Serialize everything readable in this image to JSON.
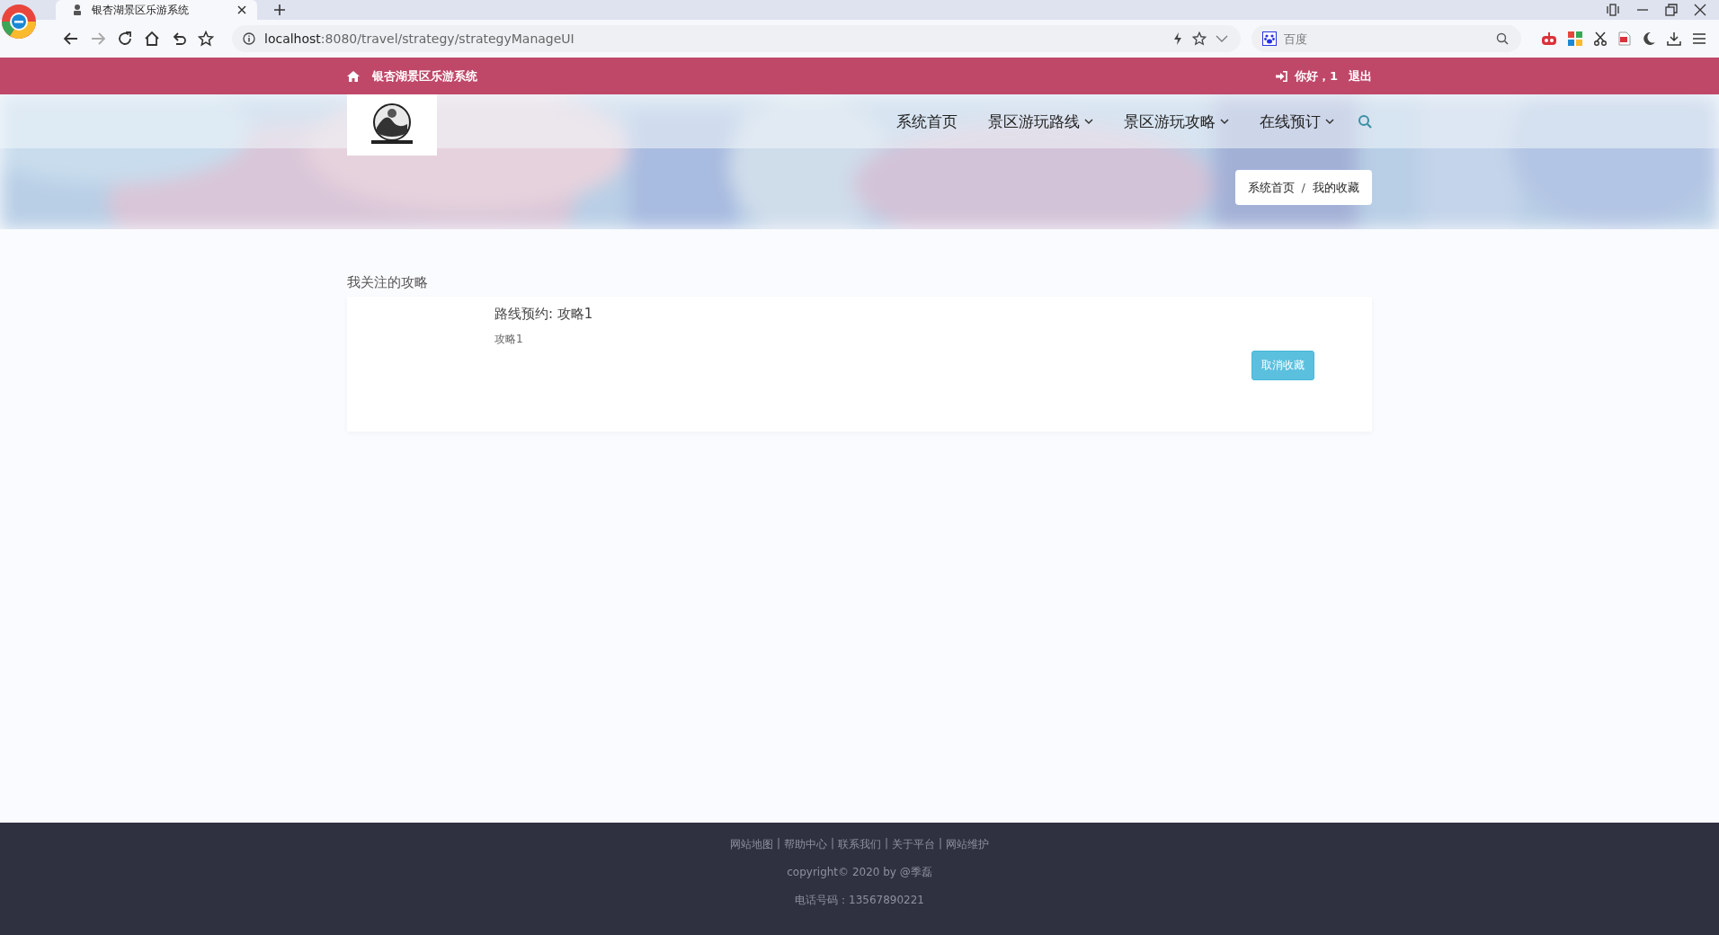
{
  "browser": {
    "tab": {
      "title": "银杏湖景区乐游系统",
      "selected": true
    },
    "address": {
      "host": "localhost",
      "path": ":8080/travel/strategy/strategyManageUI"
    },
    "search": {
      "placeholder": "百度"
    }
  },
  "topbar": {
    "site_name": "银杏湖景区乐游系统",
    "greeting": "你好，1",
    "logout": "退出"
  },
  "nav": {
    "items": [
      {
        "label": "系统首页",
        "dropdown": false
      },
      {
        "label": "景区游玩路线",
        "dropdown": true
      },
      {
        "label": "景区游玩攻略",
        "dropdown": true
      },
      {
        "label": "在线预订",
        "dropdown": true
      }
    ]
  },
  "breadcrumb": {
    "items": [
      "系统首页",
      "我的收藏"
    ],
    "separator": "/"
  },
  "section_title": "我关注的攻略",
  "favorites": [
    {
      "title": "路线预约: 攻略1",
      "subtitle": "攻略1",
      "button": "取消收藏"
    }
  ],
  "footer": {
    "links": [
      "网站地图",
      "帮助中心",
      "联系我们",
      "关于平台",
      "网站维护"
    ],
    "separator": "|",
    "copyright": "copyright© 2020 by @季磊",
    "phone": "电话号码：13567890221"
  }
}
